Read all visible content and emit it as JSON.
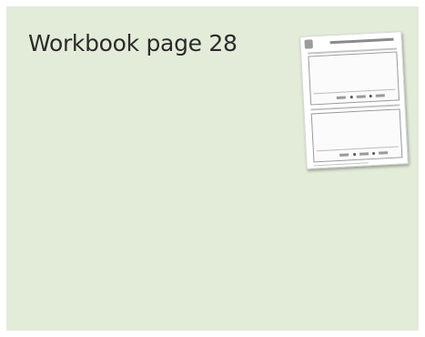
{
  "slide": {
    "title": "Workbook page 28",
    "background_color": "#e3ecd9",
    "thumbnail_icon": "worksheet-thumbnail"
  }
}
